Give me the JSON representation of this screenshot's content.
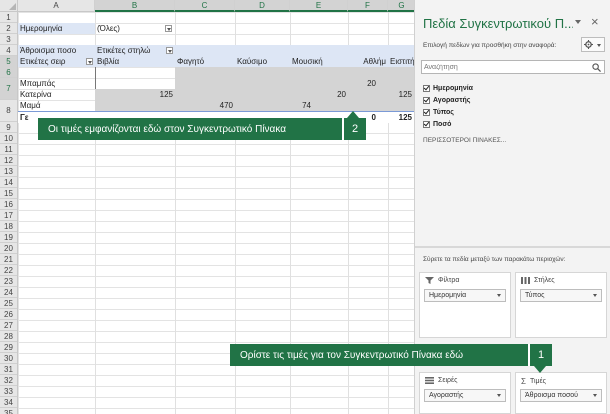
{
  "sheet": {
    "columns": [
      "A",
      "B",
      "C",
      "D",
      "E",
      "F",
      "G"
    ],
    "rows": [
      "1",
      "2",
      "3",
      "4",
      "5",
      "6",
      "7",
      "8",
      "9",
      "10",
      "11",
      "12",
      "13",
      "14",
      "15",
      "16",
      "17",
      "18",
      "19",
      "20",
      "21",
      "22",
      "23",
      "24",
      "25",
      "26",
      "27",
      "28",
      "29",
      "30",
      "31",
      "32",
      "33",
      "34",
      "35"
    ],
    "filter_label": "Ημερομηνία",
    "filter_value": "(Όλες)",
    "values_label": "Άθροισμα ποσο",
    "col_labels": "Ετικέτες στηλώ",
    "row_labels": "Ετικέτες σειρ",
    "categories": [
      "Βιβλία",
      "Φαγητό",
      "Καύσιμο",
      "Μουσική",
      "Αθλήμ",
      "Ειστιτήρ"
    ],
    "people": [
      "Μπαμπάς",
      "Κατερίνα",
      "Μαμά"
    ],
    "values": {
      "r5_f": "20",
      "r6_b": "125",
      "r6_e": "20",
      "r6_g": "125",
      "r7_c": "470",
      "r7_d": "74"
    },
    "total_label": "Γε",
    "total_f": "0",
    "total_g": "125"
  },
  "callouts": {
    "values_here": {
      "text": "Οι τιμές εμφανίζονται εδώ στον Συγκεντρωτικό Πίνακα",
      "num": "2"
    },
    "set_values": {
      "text": "Ορίστε τις τιμές για τον Συγκεντρωτικό Πίνακα εδώ",
      "num": "1"
    }
  },
  "pane": {
    "title": "Πεδία Συγκεντρωτικού Π...",
    "close": "×",
    "subtitle": "Επιλογή πεδίων για προσθήκη στην αναφορά:",
    "search_placeholder": "Αναζήτηση",
    "fields": [
      "Ημερομηνία",
      "Αγοραστής",
      "Τύπος",
      "Ποσό"
    ],
    "more_tables": "ΠΕΡΙΣΣΟΤΕΡΟΙ ΠΙΝΑΚΕΣ...",
    "drag_hint": "Σύρετε τα πεδία μεταξύ των παρακάτω περιοχών:",
    "areas": {
      "filters": {
        "title": "Φίλτρα",
        "item": "Ημερομηνία"
      },
      "columns": {
        "title": "Στήλες",
        "item": "Τύπος"
      },
      "rows": {
        "title": "Σειρές",
        "item": "Αγοραστής"
      },
      "values": {
        "title": "Τιμές",
        "item": "Άθροισμα ποσού"
      }
    }
  },
  "colors": {
    "accent": "#217346",
    "header_fill": "#dde6f5",
    "selection": "#d4d4d4"
  }
}
